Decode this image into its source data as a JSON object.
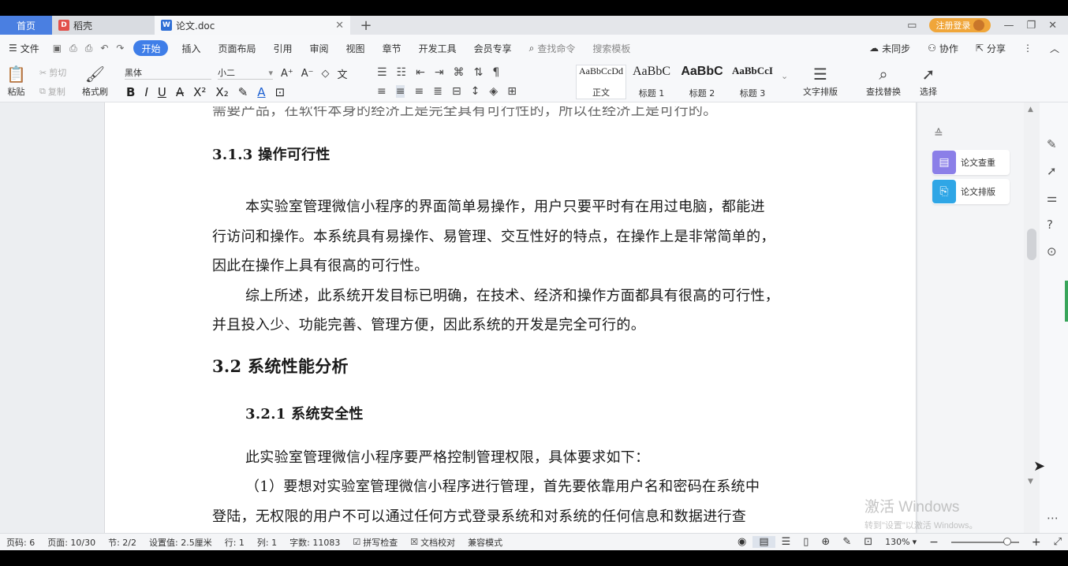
{
  "tabs": {
    "home": "首页",
    "draft": "稻壳",
    "doc": "论文.doc",
    "login": "注册登录"
  },
  "menu": {
    "file": "文件",
    "items": [
      "开始",
      "插入",
      "页面布局",
      "引用",
      "审阅",
      "视图",
      "章节",
      "开发工具",
      "会员专享"
    ],
    "search_cmd": "查找命令",
    "search_tpl": "搜索模板",
    "sync": "未同步",
    "collab": "协作",
    "share": "分享"
  },
  "ribbon": {
    "paste": "粘贴",
    "cut": "剪切",
    "copy": "复制",
    "format_painter": "格式刷",
    "font_name": "黑体",
    "font_size": "小二",
    "styles": [
      {
        "sample": "AaBbCcDd",
        "label": "正文"
      },
      {
        "sample": "AaBbC",
        "label": "标题 1"
      },
      {
        "sample": "AaBbC",
        "label": "标题 2"
      },
      {
        "sample": "AaBbCcI",
        "label": "标题 3"
      }
    ],
    "text_layout": "文字排版",
    "find_replace": "查找替换",
    "select": "选择"
  },
  "document": {
    "cut_line": "需要产品，在软件本身的经济上是完全具有可行性的，所以在经济上是可行的。",
    "h_313": "3.1.3 操作可行性",
    "p1": [
      "本实验室管理微信小程序的界面简单易操作，用户只要平时有在用过电脑，都能进",
      "行访问和操作。本系统具有易操作、易管理、交互性好的特点，在操作上是非常简单的，",
      "因此在操作上具有很高的可行性。"
    ],
    "p2": [
      "综上所述，此系统开发目标已明确，在技术、经济和操作方面都具有很高的可行性，",
      "并且投入少、功能完善、管理方便，因此系统的开发是完全可行的。"
    ],
    "h_32": "3.2 系统性能分析",
    "h_321": "3.2.1 系统安全性",
    "p3": "此实验室管理微信小程序要严格控制管理权限，具体要求如下：",
    "p4": [
      "（1）要想对实验室管理微信小程序进行管理，首先要依靠用户名和密码在系统中",
      "登陆，无权限的用户不可以通过任何方式登录系统和对系统的任何信息和数据进行查"
    ]
  },
  "sidepanel": {
    "check": "论文查重",
    "layout": "论文排版"
  },
  "watermark": {
    "line1": "激活 Windows",
    "line2": "转到\"设置\"以激活 Windows。"
  },
  "status": {
    "page_no": "页码: 6",
    "pages": "页面: 10/30",
    "section": "节: 2/2",
    "setting": "设置值: 2.5厘米",
    "row": "行: 1",
    "col": "列: 1",
    "words": "字数: 11083",
    "spell": "拼写检查",
    "proof": "文档校对",
    "compat": "兼容模式",
    "zoom": "130%"
  },
  "colors": {
    "accent": "#3f7ee8",
    "home_tab": "#4a7fe1",
    "login": "#f0a63a"
  }
}
